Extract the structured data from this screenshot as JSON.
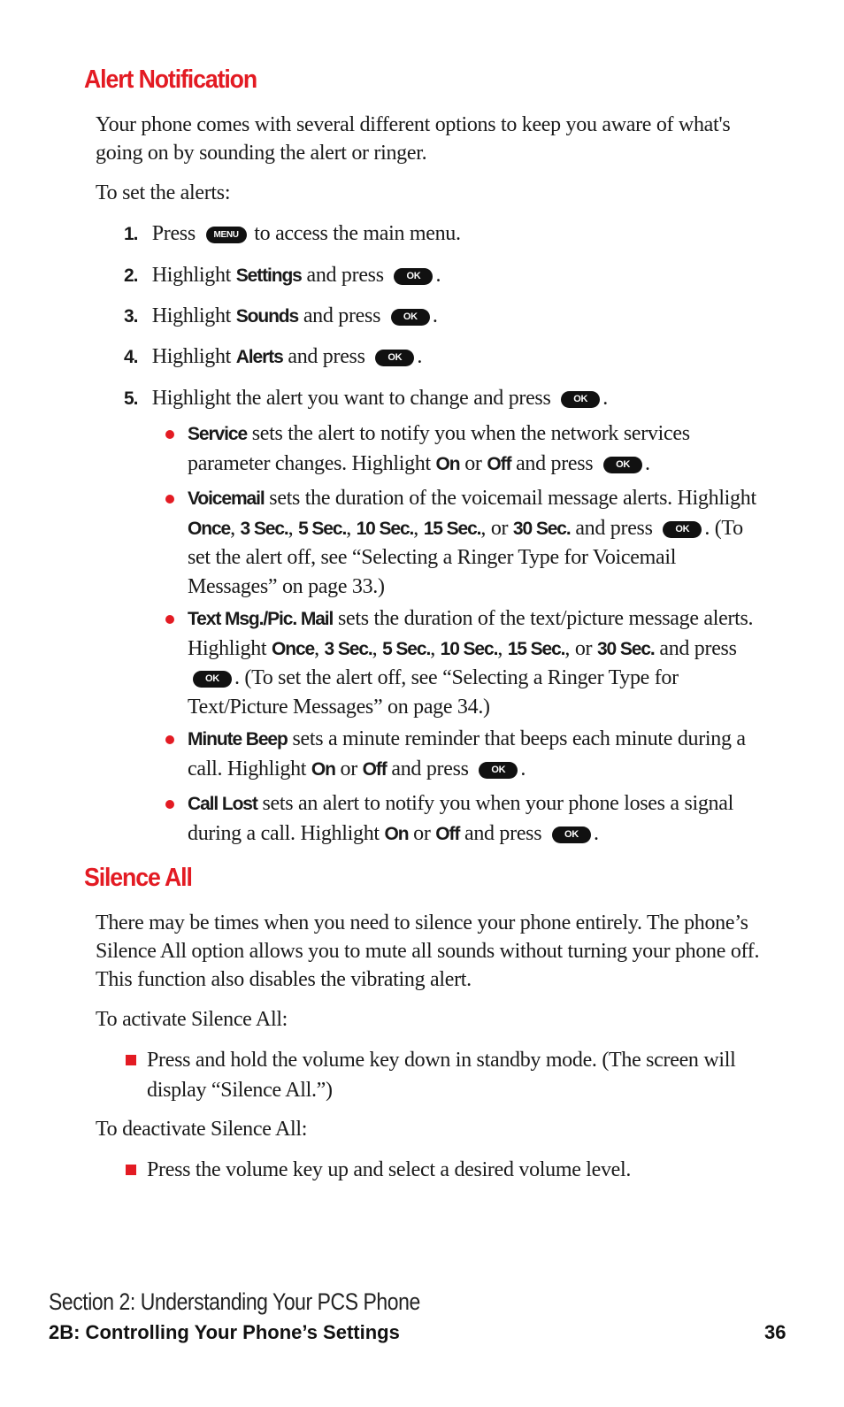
{
  "alert_section": {
    "title": "Alert Notification",
    "intro": "Your phone comes with several different options to keep you aware of what's going on by sounding the alert or ringer.",
    "lead": "To set the alerts:",
    "steps": [
      {
        "num": "1.",
        "pre": "Press",
        "key": "MENU",
        "post": "to access the main menu."
      },
      {
        "num": "2.",
        "pre": "Highlight",
        "bold": "Settings",
        "mid": "and press",
        "key": "OK",
        "post": "."
      },
      {
        "num": "3.",
        "pre": "Highlight",
        "bold": "Sounds",
        "mid": "and press",
        "key": "OK",
        "post": "."
      },
      {
        "num": "4.",
        "pre": "Highlight",
        "bold": "Alerts",
        "mid": "and press",
        "key": "OK",
        "post": "."
      },
      {
        "num": "5.",
        "pre": "Highlight the alert you want to change and press",
        "key": "OK",
        "post": "."
      }
    ],
    "alerts": [
      {
        "name": "Service",
        "desc": "sets the alert to notify you when the network services parameter changes. Highlight",
        "opt1": "On",
        "or": "or",
        "opt2": "Off",
        "and_press": "and press",
        "key": "OK",
        "end": "."
      },
      {
        "name": "Voicemail",
        "desc": "sets the duration of the voicemail message alerts. Highlight",
        "options": [
          "Once",
          "3 Sec.",
          "5 Sec.",
          "10 Sec.",
          "15 Sec.",
          "30 Sec."
        ],
        "or": "or",
        "and": "and",
        "press": "press",
        "key": "OK",
        "note": ". (To set the alert off, see “Selecting a Ringer Type for Voicemail Messages” on page 33.)"
      },
      {
        "name": "Text Msg./Pic. Mail",
        "desc": "sets the duration of the text/picture message alerts. Highlight",
        "options": [
          "Once",
          "3 Sec.",
          "5 Sec.",
          "10 Sec.",
          "15 Sec.",
          "30 Sec."
        ],
        "or": "or",
        "and_press": "and press",
        "key": "OK",
        "note": ". (To set the alert off, see “Selecting a Ringer Type for Text/Picture Messages” on page 34.)"
      },
      {
        "name": "Minute Beep",
        "desc": "sets a minute reminder that beeps each minute during a call. Highlight",
        "opt1": "On",
        "or": "or",
        "opt2": "Off",
        "and_press": "and press",
        "key": "OK",
        "end": "."
      },
      {
        "name": "Call Lost",
        "desc": "sets an alert to notify you when your phone loses a signal during a call. Highlight",
        "opt1": "On",
        "or": "or",
        "opt2": "Off",
        "and_press": "and press",
        "key": "OK",
        "end": "."
      }
    ]
  },
  "silence_section": {
    "title": "Silence All",
    "intro": "There may be times when you need to silence your phone entirely. The phone’s Silence All option allows you to mute all sounds without turning your phone off. This function also disables the vibrating alert.",
    "activate_lead": "To activate Silence All:",
    "activate_item": "Press and hold the volume key down in standby mode. (The screen will display “Silence All.”)",
    "deactivate_lead": "To deactivate Silence All:",
    "deactivate_item": "Press the volume key up and select a desired volume level."
  },
  "footer": {
    "section": "Section 2: Understanding Your PCS Phone",
    "chapter": "2B: Controlling Your Phone’s Settings",
    "page": "36"
  },
  "colors": {
    "accent": "#e31b23",
    "text": "#1a1a1a",
    "key_bg": "#111111"
  }
}
